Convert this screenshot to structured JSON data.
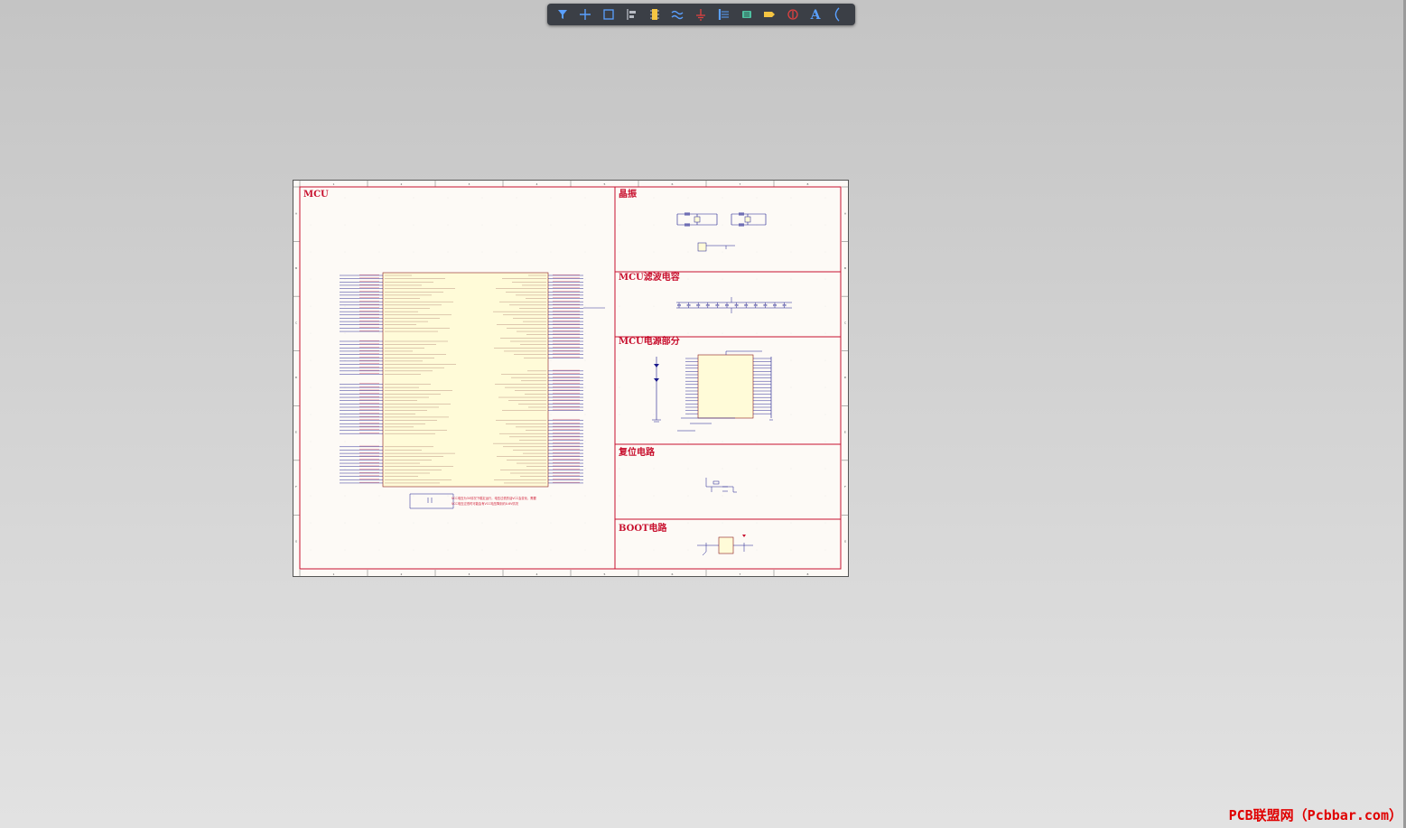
{
  "toolbar": {
    "tools": [
      {
        "name": "filter-icon",
        "color": "#5aa0ff"
      },
      {
        "name": "crosshair-icon",
        "color": "#5aa0ff"
      },
      {
        "name": "select-rect-icon",
        "color": "#5aa0ff"
      },
      {
        "name": "align-icon",
        "color": "#b8bcc4"
      },
      {
        "name": "component-icon",
        "color": "#f5c542"
      },
      {
        "name": "wire-icon",
        "color": "#5aa0ff"
      },
      {
        "name": "ground-icon",
        "color": "#e04040"
      },
      {
        "name": "bus-icon",
        "color": "#5aa0ff"
      },
      {
        "name": "harness-icon",
        "color": "#4ec0a0"
      },
      {
        "name": "net-label-icon",
        "color": "#f5c542"
      },
      {
        "name": "no-erc-icon",
        "color": "#e04040"
      },
      {
        "name": "text-tool-icon",
        "color": "#5aa0ff",
        "label": "A"
      },
      {
        "name": "arc-icon",
        "color": "#5aa0ff"
      }
    ]
  },
  "sheet": {
    "sections": {
      "mcu": "MCU",
      "crystal": "晶振",
      "filter_caps": "MCU滤波电容",
      "power": "MCU电源部分",
      "reset": "复位电路",
      "boot": "BOOT电路"
    },
    "col_numbers": [
      "1",
      "2",
      "3",
      "4",
      "5",
      "6",
      "7",
      "8"
    ],
    "row_letters": [
      "A",
      "B",
      "C",
      "D",
      "E",
      "F",
      "G"
    ],
    "note_lines": [
      "VCC电压为3V情况下稳定运行，电压过低的话VCC会变化，需要",
      "VCC电压过低时可能会有VCC电压降到约0.6V情况"
    ],
    "colors": {
      "border": "#c8102e",
      "component_body": "#fffbd8",
      "wire": "#1a1a8c",
      "pin_label": "#c8102e",
      "background": "#fdfaf6"
    }
  },
  "watermark": "PCB联盟网（Pcbbar.com）"
}
